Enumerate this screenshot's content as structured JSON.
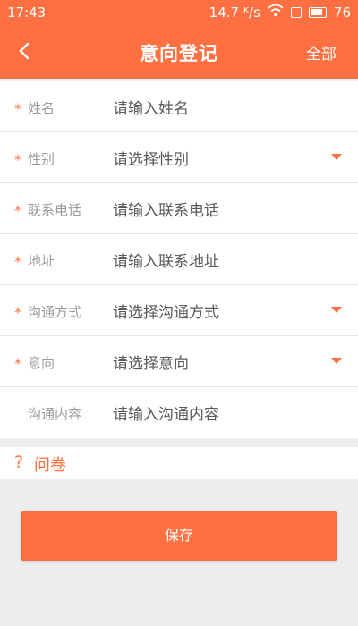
{
  "status_bar": {
    "time": "17:43",
    "network_speed": "14.7 ᴷ/s",
    "battery": "76"
  },
  "navbar": {
    "title": "意向登记",
    "action_label": "全部"
  },
  "form": {
    "fields": [
      {
        "required": true,
        "label": "姓名",
        "placeholder": "请输入姓名",
        "dropdown": false
      },
      {
        "required": true,
        "label": "性别",
        "placeholder": "请选择性别",
        "dropdown": true
      },
      {
        "required": true,
        "label": "联系电话",
        "placeholder": "请输入联系电话",
        "dropdown": false
      },
      {
        "required": true,
        "label": "地址",
        "placeholder": "请输入联系地址",
        "dropdown": false
      },
      {
        "required": true,
        "label": "沟通方式",
        "placeholder": "请选择沟通方式",
        "dropdown": true
      },
      {
        "required": true,
        "label": "意向",
        "placeholder": "请选择意向",
        "dropdown": true
      },
      {
        "required": false,
        "label": "沟通内容",
        "placeholder": "请输入沟通内容",
        "dropdown": false
      }
    ],
    "required_mark": "*"
  },
  "survey": {
    "icon": "?",
    "label": "问卷"
  },
  "save_button": {
    "label": "保存"
  },
  "colors": {
    "accent": "#fe7041",
    "background": "#ededed",
    "label_gray": "#9b9b9b"
  }
}
